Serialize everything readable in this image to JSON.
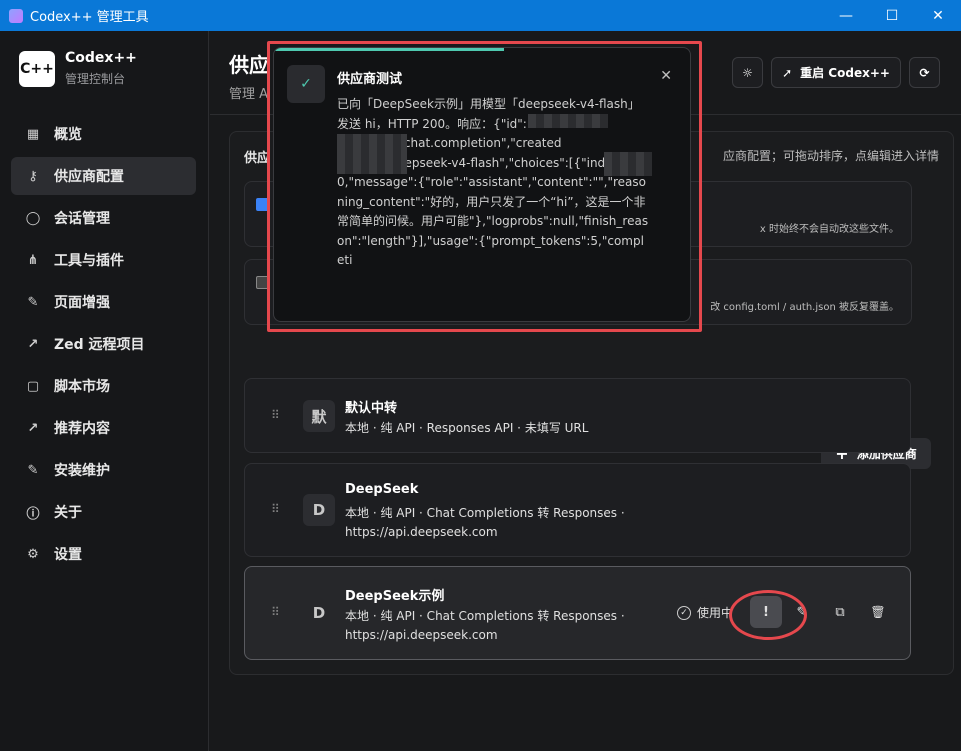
{
  "window": {
    "title": "Codex++ 管理工具",
    "minimize": "—",
    "maximize": "☐",
    "close": "✕"
  },
  "brand": {
    "logo": "C++",
    "name": "Codex++",
    "subtitle": "管理控制台"
  },
  "nav": [
    {
      "label": "概览",
      "icon": "▦"
    },
    {
      "label": "供应商配置",
      "icon": "⚷",
      "active": true
    },
    {
      "label": "会话管理",
      "icon": "◯"
    },
    {
      "label": "工具与插件",
      "icon": "⋔"
    },
    {
      "label": "页面增强",
      "icon": "✎"
    },
    {
      "label": "Zed 远程项目",
      "icon": "↗"
    },
    {
      "label": "脚本市场",
      "icon": "▢"
    },
    {
      "label": "推荐内容",
      "icon": "↗"
    },
    {
      "label": "安装维护",
      "icon": "✎"
    },
    {
      "label": "关于",
      "icon": "ⓘ"
    },
    {
      "label": "设置",
      "icon": "⚙"
    }
  ],
  "header": {
    "title": "供应",
    "subtitle": "管理 A",
    "restart_label": "重启 Codex++",
    "theme_icon": "☼",
    "restart_icon": "➚",
    "refresh_icon": "⟳"
  },
  "panel": {
    "label": "供应",
    "hint": "应商配置；可拖动排序，点编辑进入详情",
    "option1_desc": "x 时始终不会自动改这些文件。",
    "option2_desc": "改 config.toml / auth.json 被反复覆盖。",
    "option1_checked": true,
    "option2_checked": false
  },
  "add_button": {
    "icon": "+",
    "label": "添加供应商"
  },
  "providers": [
    {
      "avatar": "默",
      "name": "默认中转",
      "desc": "本地 · 纯 API · Responses API · 未填写 URL",
      "drag": "⠿"
    },
    {
      "avatar": "D",
      "name": "DeepSeek",
      "desc": "本地 · 纯 API · Chat Completions 转 Responses · https://api.deepseek.com",
      "drag": "⠿"
    },
    {
      "avatar": "D",
      "name": "DeepSeek示例",
      "desc": "本地 · 纯 API · Chat Completions 转 Responses · https://api.deepseek.com",
      "drag": "⠿",
      "current": true
    }
  ],
  "current_actions": {
    "inuse_icon": "✓",
    "inuse_label": "使用中",
    "test_icon": "!",
    "edit_icon": "✎",
    "copy_icon": "⧉",
    "delete_icon": "🗑"
  },
  "toast": {
    "title": "供应商测试",
    "icon": "✓",
    "close": "✕",
    "body": "已向「DeepSeek示例」用模型「deepseek-v4-flash」发送 hi，HTTP 200。响应：{\"id\":\"                                                \",\"object\":\"chat.completion\",\"created                             model\":\"deepseek-v4-flash\",\"choices\":[{\"index\":0,\"message\":{\"role\":\"assistant\",\"content\":\"\",\"reasoning_content\":\"好的，用户只发了一个“hi”，这是一个非常简单的问候。用户可能\"},\"logprobs\":null,\"finish_reason\":\"length\"}],\"usage\":{\"prompt_tokens\":5,\"completi"
  },
  "colors": {
    "accent": "#4ec9b0",
    "annotation": "#e5484d",
    "titlebar": "#0a78d7"
  }
}
